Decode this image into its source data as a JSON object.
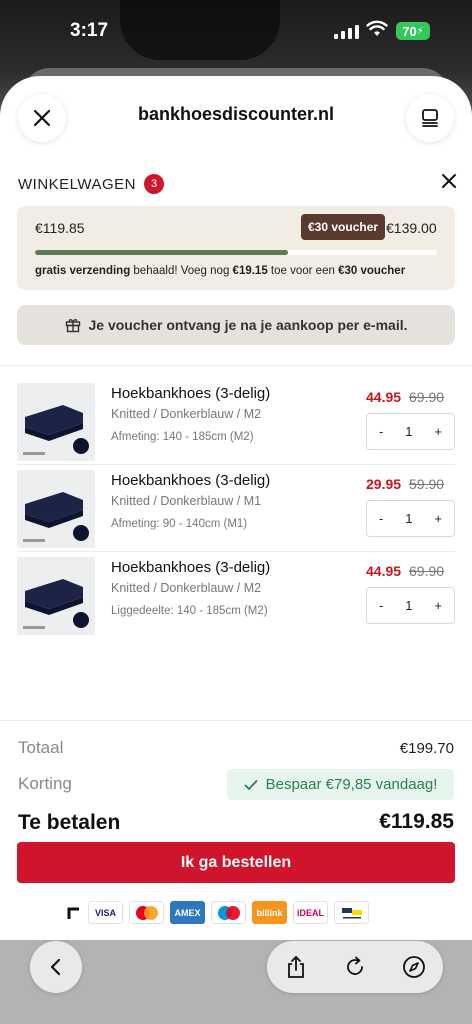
{
  "status_bar": {
    "time": "3:17",
    "battery": "70"
  },
  "browser": {
    "domain": "bankhoesdiscounter.nl"
  },
  "cart": {
    "title": "WINKELWAGEN",
    "count": "3",
    "progress": {
      "current": "€119.85",
      "voucher_badge": "€30 voucher",
      "target": "€139.00",
      "fill_percent": 63,
      "msg_part1": "gratis verzending",
      "msg_part2": " behaald! Voeg nog ",
      "msg_amount": "€19.15",
      "msg_part3": " toe voor een ",
      "msg_voucher": "€30 voucher"
    },
    "voucher_info": "Je voucher ontvang je na je aankoop per e-mail.",
    "items": [
      {
        "name": "Hoekbankhoes (3-delig)",
        "variant": "Knitted  /  Donkerblauw  /  M2",
        "size": "Afmeting: 140 - 185cm (M2)",
        "price": "44.95",
        "old_price": "69.90",
        "qty": "1"
      },
      {
        "name": "Hoekbankhoes (3-delig)",
        "variant": "Knitted  /  Donkerblauw  /  M1",
        "size": "Afmeting: 90 - 140cm (M1)",
        "price": "29.95",
        "old_price": "59.90",
        "qty": "1"
      },
      {
        "name": "Hoekbankhoes (3-delig)",
        "variant": "Knitted  /  Donkerblauw  /  M2",
        "size": "Liggedeelte: 140 - 185cm (M2)",
        "price": "44.95",
        "old_price": "69.90",
        "qty": "1"
      }
    ],
    "stepper": {
      "minus": "-",
      "plus": "+"
    }
  },
  "totals": {
    "total_label": "Totaal",
    "total_value": "€199.70",
    "discount_label": "Korting",
    "discount_value": "Bespaar €79,85 vandaag!",
    "pay_label": "Te betalen",
    "pay_value": "€119.85"
  },
  "order_button": "Ik ga bestellen",
  "payment_methods": [
    "VISA",
    "mastercard",
    "AMEX",
    "maestro",
    "billink",
    "iDEAL",
    "Bancontact"
  ],
  "colors": {
    "accent": "#d0142c",
    "progress": "#5d7a52",
    "voucher": "#5a3a2e",
    "save": "#2e7d4f"
  }
}
